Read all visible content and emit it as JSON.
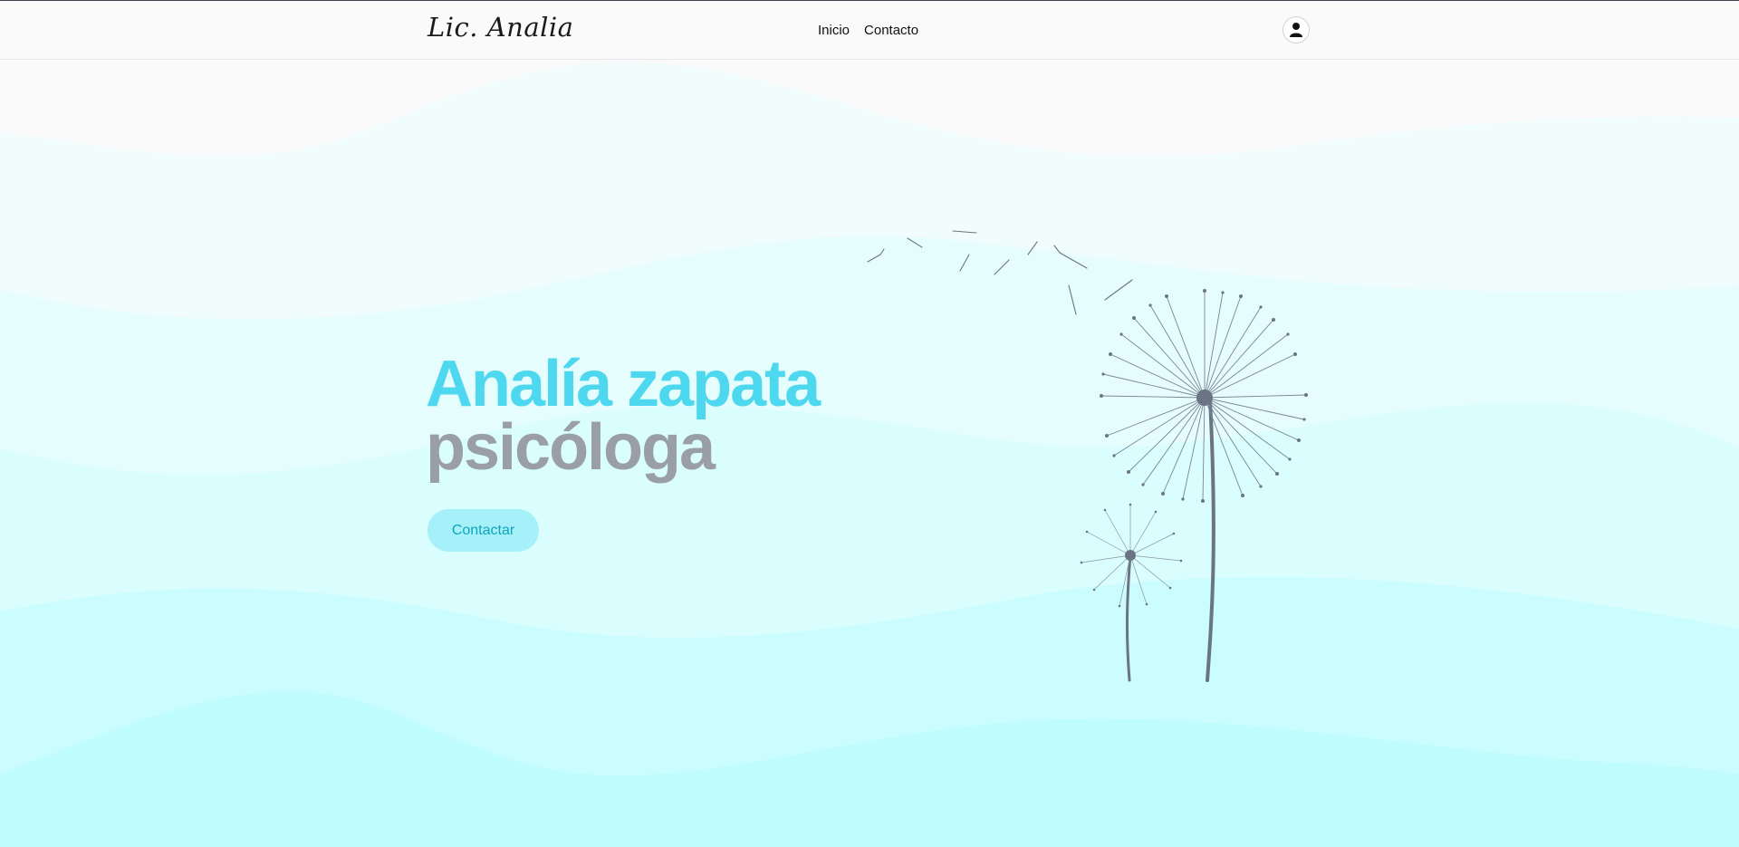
{
  "header": {
    "brand": "Lic. Analia",
    "nav": [
      {
        "label": "Inicio"
      },
      {
        "label": "Contacto"
      }
    ],
    "account_icon": "user-icon"
  },
  "hero": {
    "title_line1": "Analía zapata",
    "title_line2": "psicóloga",
    "cta_label": "Contactar",
    "illustration": "dandelion-illustration"
  },
  "colors": {
    "title_accent": "#4dd8ef",
    "title_muted": "#9a9ea8",
    "cta_bg": "#a6f0f9",
    "cta_text": "#0ea5bd",
    "wave_light": "#f0fcfd",
    "wave_dark": "#b8fbfe"
  }
}
